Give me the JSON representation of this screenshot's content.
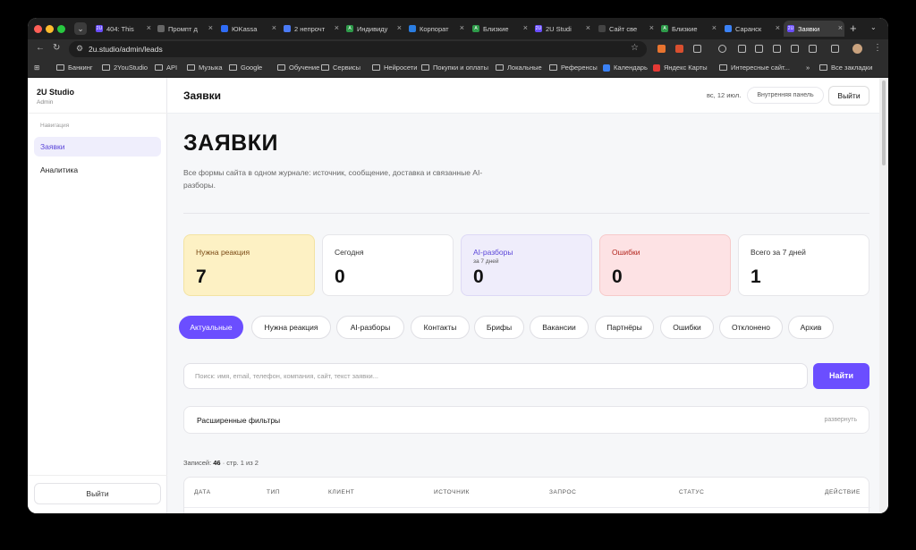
{
  "browser": {
    "tabs": [
      {
        "label": "404: This",
        "fav": "#6b4eff",
        "fav_text": "2U"
      },
      {
        "label": "Промпт д",
        "fav": "#666",
        "fav_text": ""
      },
      {
        "label": "ЮKassa",
        "fav": "#2f6cf6",
        "fav_text": ""
      },
      {
        "label": "2 непрочт",
        "fav": "#4b7bf5",
        "fav_text": ""
      },
      {
        "label": "Индивиду",
        "fav": "#2e9b4a",
        "fav_text": "A"
      },
      {
        "label": "Корпорат",
        "fav": "#2a7de1",
        "fav_text": ""
      },
      {
        "label": "Близкие",
        "fav": "#2e9b4a",
        "fav_text": "A"
      },
      {
        "label": "2U Studi",
        "fav": "#6b4eff",
        "fav_text": "2U"
      },
      {
        "label": "Сайт све",
        "fav": "#444",
        "fav_text": ""
      },
      {
        "label": "Близкие",
        "fav": "#2e9b4a",
        "fav_text": "A"
      },
      {
        "label": "Саранск",
        "fav": "#3b82f6",
        "fav_text": ""
      },
      {
        "label": "Заявки",
        "fav": "#6b4eff",
        "fav_text": "2U"
      }
    ],
    "new_tab": "+",
    "url": "2u.studio/admin/leads",
    "bookmarks": [
      {
        "label": "Банкинг",
        "type": "folder"
      },
      {
        "label": "2YouStudio",
        "type": "folder"
      },
      {
        "label": "API",
        "type": "folder"
      },
      {
        "label": "Музыка",
        "type": "folder"
      },
      {
        "label": "Google",
        "type": "folder"
      },
      {
        "label": "Обучение",
        "type": "folder"
      },
      {
        "label": "Сервисы",
        "type": "folder"
      },
      {
        "label": "Нейросети",
        "type": "folder"
      },
      {
        "label": "Покупки и оплаты",
        "type": "folder"
      },
      {
        "label": "Локальные",
        "type": "folder"
      },
      {
        "label": "Референсы",
        "type": "folder"
      },
      {
        "label": "Календарь",
        "type": "site",
        "color": "#3b82f6"
      },
      {
        "label": "Яндекс Карты",
        "type": "site",
        "color": "#e53935"
      },
      {
        "label": "Интересные сайт...",
        "type": "folder"
      }
    ],
    "bookmarks_more": "»",
    "all_bookmarks": "Все закладки"
  },
  "sidebar": {
    "brand": "2U Studio",
    "role": "Admin",
    "nav_title": "Навигация",
    "items": [
      {
        "label": "Заявки",
        "active": true
      },
      {
        "label": "Аналитика",
        "active": false
      }
    ],
    "logout": "Выйти"
  },
  "topbar": {
    "title": "Заявки",
    "date": "вс, 12 июл.",
    "panel": "Внутренняя панель",
    "logout": "Выйти"
  },
  "main": {
    "heading": "ЗАЯВКИ",
    "description": "Все формы сайта в одном журнале: источник, сообщение, доставка и связанные AI-разборы."
  },
  "stats": [
    {
      "label": "Нужна реакция",
      "sub": "",
      "value": "7",
      "style": "yellow"
    },
    {
      "label": "Сегодня",
      "sub": "",
      "value": "0",
      "style": "white"
    },
    {
      "label": "AI-разборы",
      "sub": "за 7 дней",
      "value": "0",
      "style": "lilac"
    },
    {
      "label": "Ошибки",
      "sub": "",
      "value": "0",
      "style": "pink"
    },
    {
      "label": "Всего за 7 дней",
      "sub": "",
      "value": "1",
      "style": "white"
    }
  ],
  "filters_chips": [
    {
      "label": "Актуальные",
      "active": true
    },
    {
      "label": "Нужна реакция",
      "active": false
    },
    {
      "label": "AI-разборы",
      "active": false
    },
    {
      "label": "Контакты",
      "active": false
    },
    {
      "label": "Брифы",
      "active": false
    },
    {
      "label": "Вакансии",
      "active": false
    },
    {
      "label": "Партнёры",
      "active": false
    },
    {
      "label": "Ошибки",
      "active": false
    },
    {
      "label": "Отклонено",
      "active": false
    },
    {
      "label": "Архив",
      "active": false
    }
  ],
  "search": {
    "placeholder": "Поиск: имя, email, телефон, компания, сайт, текст заявки...",
    "button": "Найти"
  },
  "advanced_filters": {
    "label": "Расширенные фильтры",
    "expand": "развернуть"
  },
  "records": {
    "prefix": "Записей:",
    "count": "46",
    "suffix": "· стр. 1 из 2"
  },
  "table": {
    "headers": [
      "ДАТА",
      "ТИП",
      "КЛИЕНТ",
      "ИСТОЧНИК",
      "ЗАПРОС",
      "СТАТУС",
      "ДЕЙСТВИЕ"
    ]
  },
  "colors": {
    "accent": "#6b4eff",
    "yellow_card": "#fdf1c4",
    "lilac_card": "#efedfb",
    "pink_card": "#fde2e4"
  }
}
